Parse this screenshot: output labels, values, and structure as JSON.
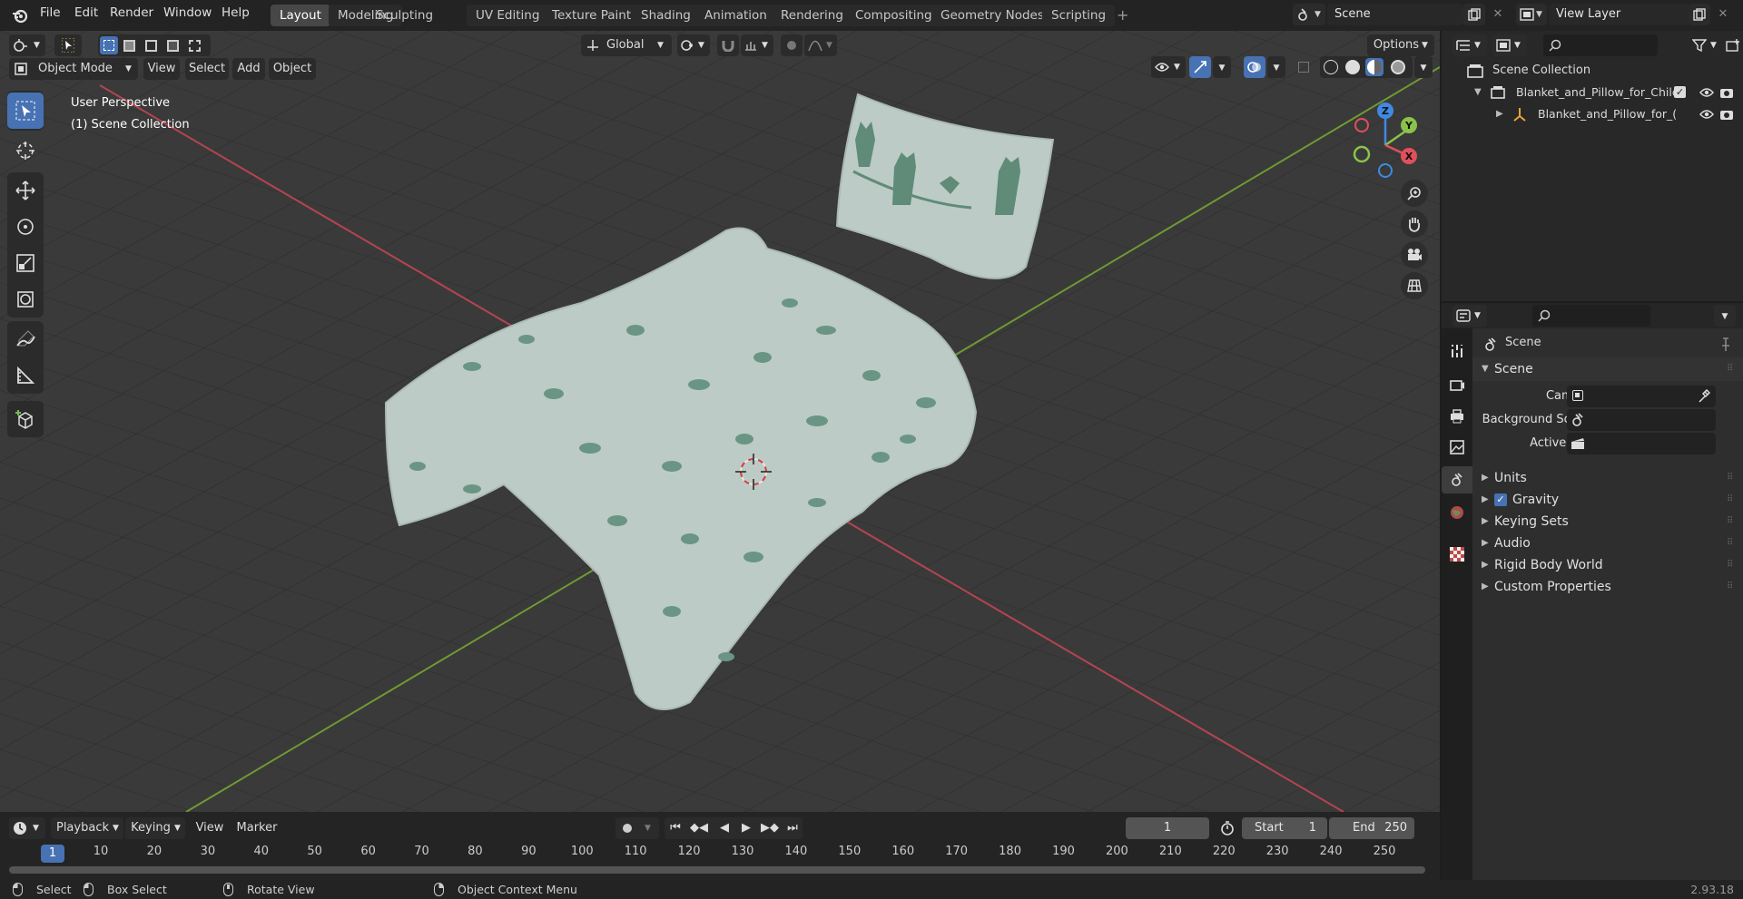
{
  "menubar": {
    "items": [
      "File",
      "Edit",
      "Render",
      "Window",
      "Help"
    ],
    "workspace_tabs": [
      "Layout",
      "Modeling",
      "Sculpting",
      "UV Editing",
      "Texture Paint",
      "Shading",
      "Animation",
      "Rendering",
      "Compositing",
      "Geometry Nodes",
      "Scripting"
    ],
    "active_tab": "Layout",
    "add_tab": "+",
    "scene_name": "Scene",
    "view_layer_name": "View Layer"
  },
  "viewport": {
    "transform_orientation": "Global",
    "options_label": "Options",
    "mode": "Object Mode",
    "header_menus": [
      "View",
      "Select",
      "Add",
      "Object"
    ],
    "overlay_text_1": "User Perspective",
    "overlay_text_2": "(1) Scene Collection",
    "gizmo_axes": {
      "x": "X",
      "y": "Y",
      "z": "Z"
    }
  },
  "timeline": {
    "menus": [
      "Playback",
      "Keying",
      "View",
      "Marker"
    ],
    "current_frame": "1",
    "start_label": "Start",
    "start_value": "1",
    "end_label": "End",
    "end_value": "250",
    "ruler_ticks": [
      "1",
      "10",
      "20",
      "30",
      "40",
      "50",
      "60",
      "70",
      "80",
      "90",
      "100",
      "110",
      "120",
      "130",
      "140",
      "150",
      "160",
      "170",
      "180",
      "190",
      "200",
      "210",
      "220",
      "230",
      "240",
      "250"
    ]
  },
  "outliner": {
    "root": "Scene Collection",
    "collection": "Blanket_and_Pillow_for_Child",
    "object": "Blanket_and_Pillow_for_("
  },
  "properties": {
    "context_title": "Scene",
    "panel_title": "Scene",
    "camera_label": "Camera",
    "background_scene_label": "Background Scene",
    "active_clip_label": "Active Clip",
    "subpanels": [
      "Units",
      "Gravity",
      "Keying Sets",
      "Audio",
      "Rigid Body World",
      "Custom Properties"
    ],
    "gravity_checked": true
  },
  "statusbar": {
    "select": "Select",
    "box_select": "Box Select",
    "rotate_view": "Rotate View",
    "context_menu": "Object Context Menu",
    "version": "2.93.18"
  },
  "colors": {
    "accent": "#4772b3",
    "x_axis": "#e0505a",
    "y_axis": "#8bc34a",
    "z_axis": "#3f8ae0",
    "viewport_bg": "#393939"
  }
}
